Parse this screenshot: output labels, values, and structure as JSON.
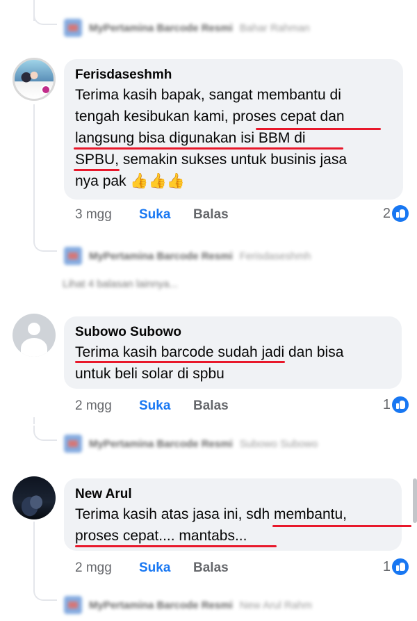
{
  "comments": [
    {
      "author": "Ferisdaseshmh",
      "lines": [
        "Terima kasih  bapak, sangat membantu di",
        "tengah kesibukan kami, proses cepat dan",
        "langsung bisa digunakan isi BBM di",
        "SPBU, semakin sukses untuk businis jasa",
        "nya pak 👍👍👍"
      ],
      "time": "3 mgg",
      "like_label": "Suka",
      "reply_label": "Balas",
      "reaction_count": "2",
      "reaction_icon": "like-icon"
    },
    {
      "author": "Subowo Subowo",
      "lines": [
        "Terima kasih barcode sudah jadi dan bisa",
        "untuk beli solar di spbu"
      ],
      "time": "2 mgg",
      "like_label": "Suka",
      "reply_label": "Balas",
      "reaction_count": "1",
      "reaction_icon": "like-icon"
    },
    {
      "author": "New Arul",
      "lines": [
        "Terima kasih atas jasa ini, sdh membantu,",
        "proses cepat.... mantabs..."
      ],
      "time": "2 mgg",
      "like_label": "Suka",
      "reply_label": "Balas",
      "reaction_count": "1",
      "reaction_icon": "like-icon"
    }
  ],
  "blurred_replies": [
    {
      "name": "MyPertamina Barcode Resmi",
      "text": "Bahar Rahman"
    },
    {
      "name": "MyPertamina Barcode Resmi",
      "text": "Ferisdaseshmh"
    },
    {
      "name": "MyPertamina Barcode Resmi",
      "text": "Subowo Subowo"
    },
    {
      "name": "MyPertamina Barcode Resmi",
      "text": "New Arul Rahm"
    }
  ],
  "more_replies_label": "Lihat 4 balasan lainnya...",
  "colors": {
    "link_blue": "#1877f2",
    "bubble_bg": "#f0f2f5",
    "highlight_red": "#e8182b"
  }
}
